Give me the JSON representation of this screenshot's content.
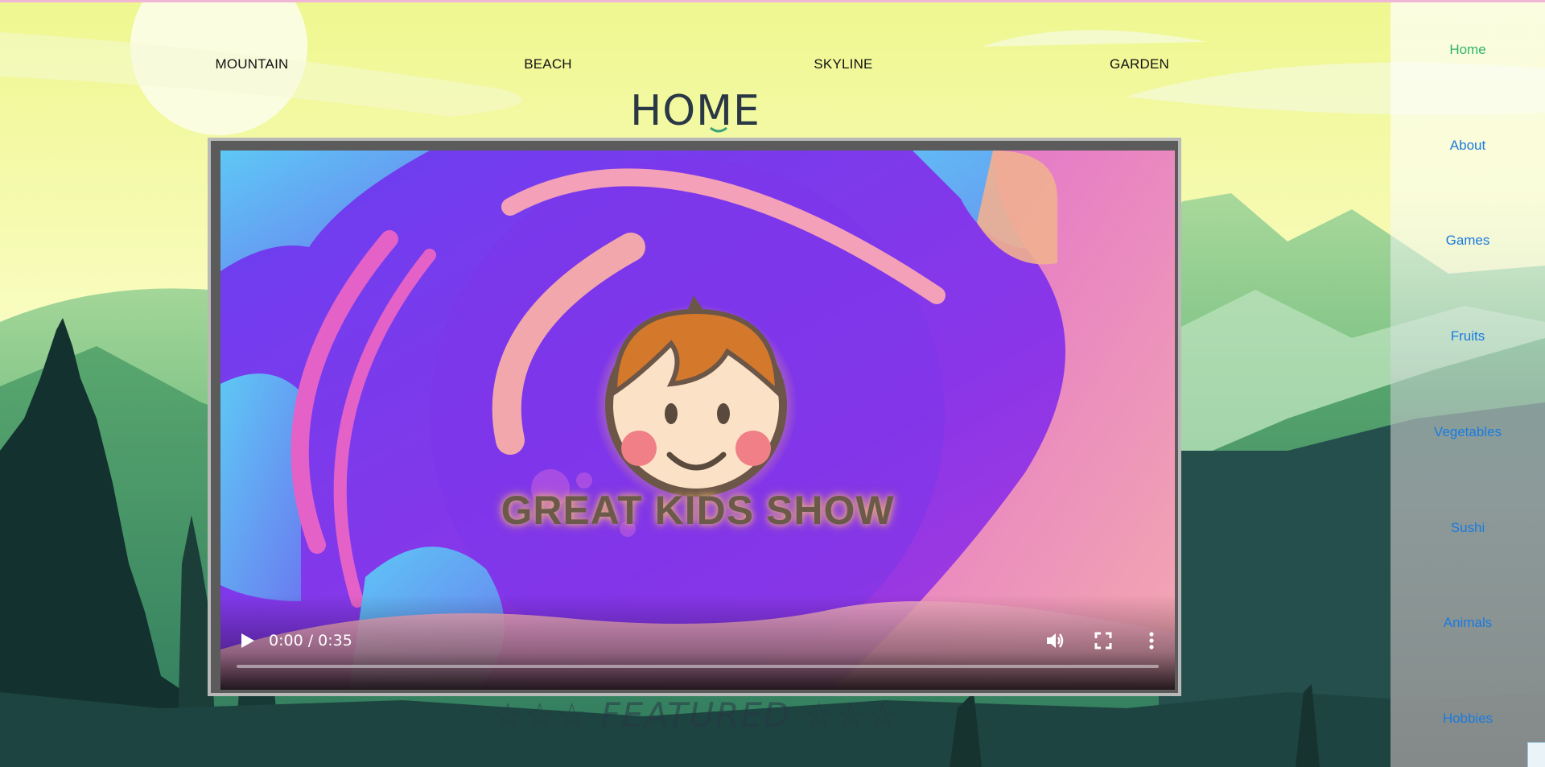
{
  "top_nav": {
    "items": [
      "MOUNTAIN",
      "BEACH",
      "SKYLINE",
      "GARDEN"
    ]
  },
  "page": {
    "title": "HOME",
    "featured": "☆☆☆ FEATURED ☆☆☆"
  },
  "video": {
    "poster_text": "GREAT KIDS SHOW",
    "time": "0:00 / 0:35",
    "progress": 0,
    "icons": [
      "play-icon",
      "volume-icon",
      "fullscreen-icon",
      "more-options-icon"
    ]
  },
  "sidebar": {
    "items": [
      {
        "label": "Home",
        "active": true
      },
      {
        "label": "About",
        "active": false
      },
      {
        "label": "Games",
        "active": false
      },
      {
        "label": "Fruits",
        "active": false
      },
      {
        "label": "Vegetables",
        "active": false
      },
      {
        "label": "Sushi",
        "active": false
      },
      {
        "label": "Animals",
        "active": false
      },
      {
        "label": "Hobbies",
        "active": false
      }
    ],
    "active_color": "#2db36b",
    "link_color": "#1a7be0"
  }
}
